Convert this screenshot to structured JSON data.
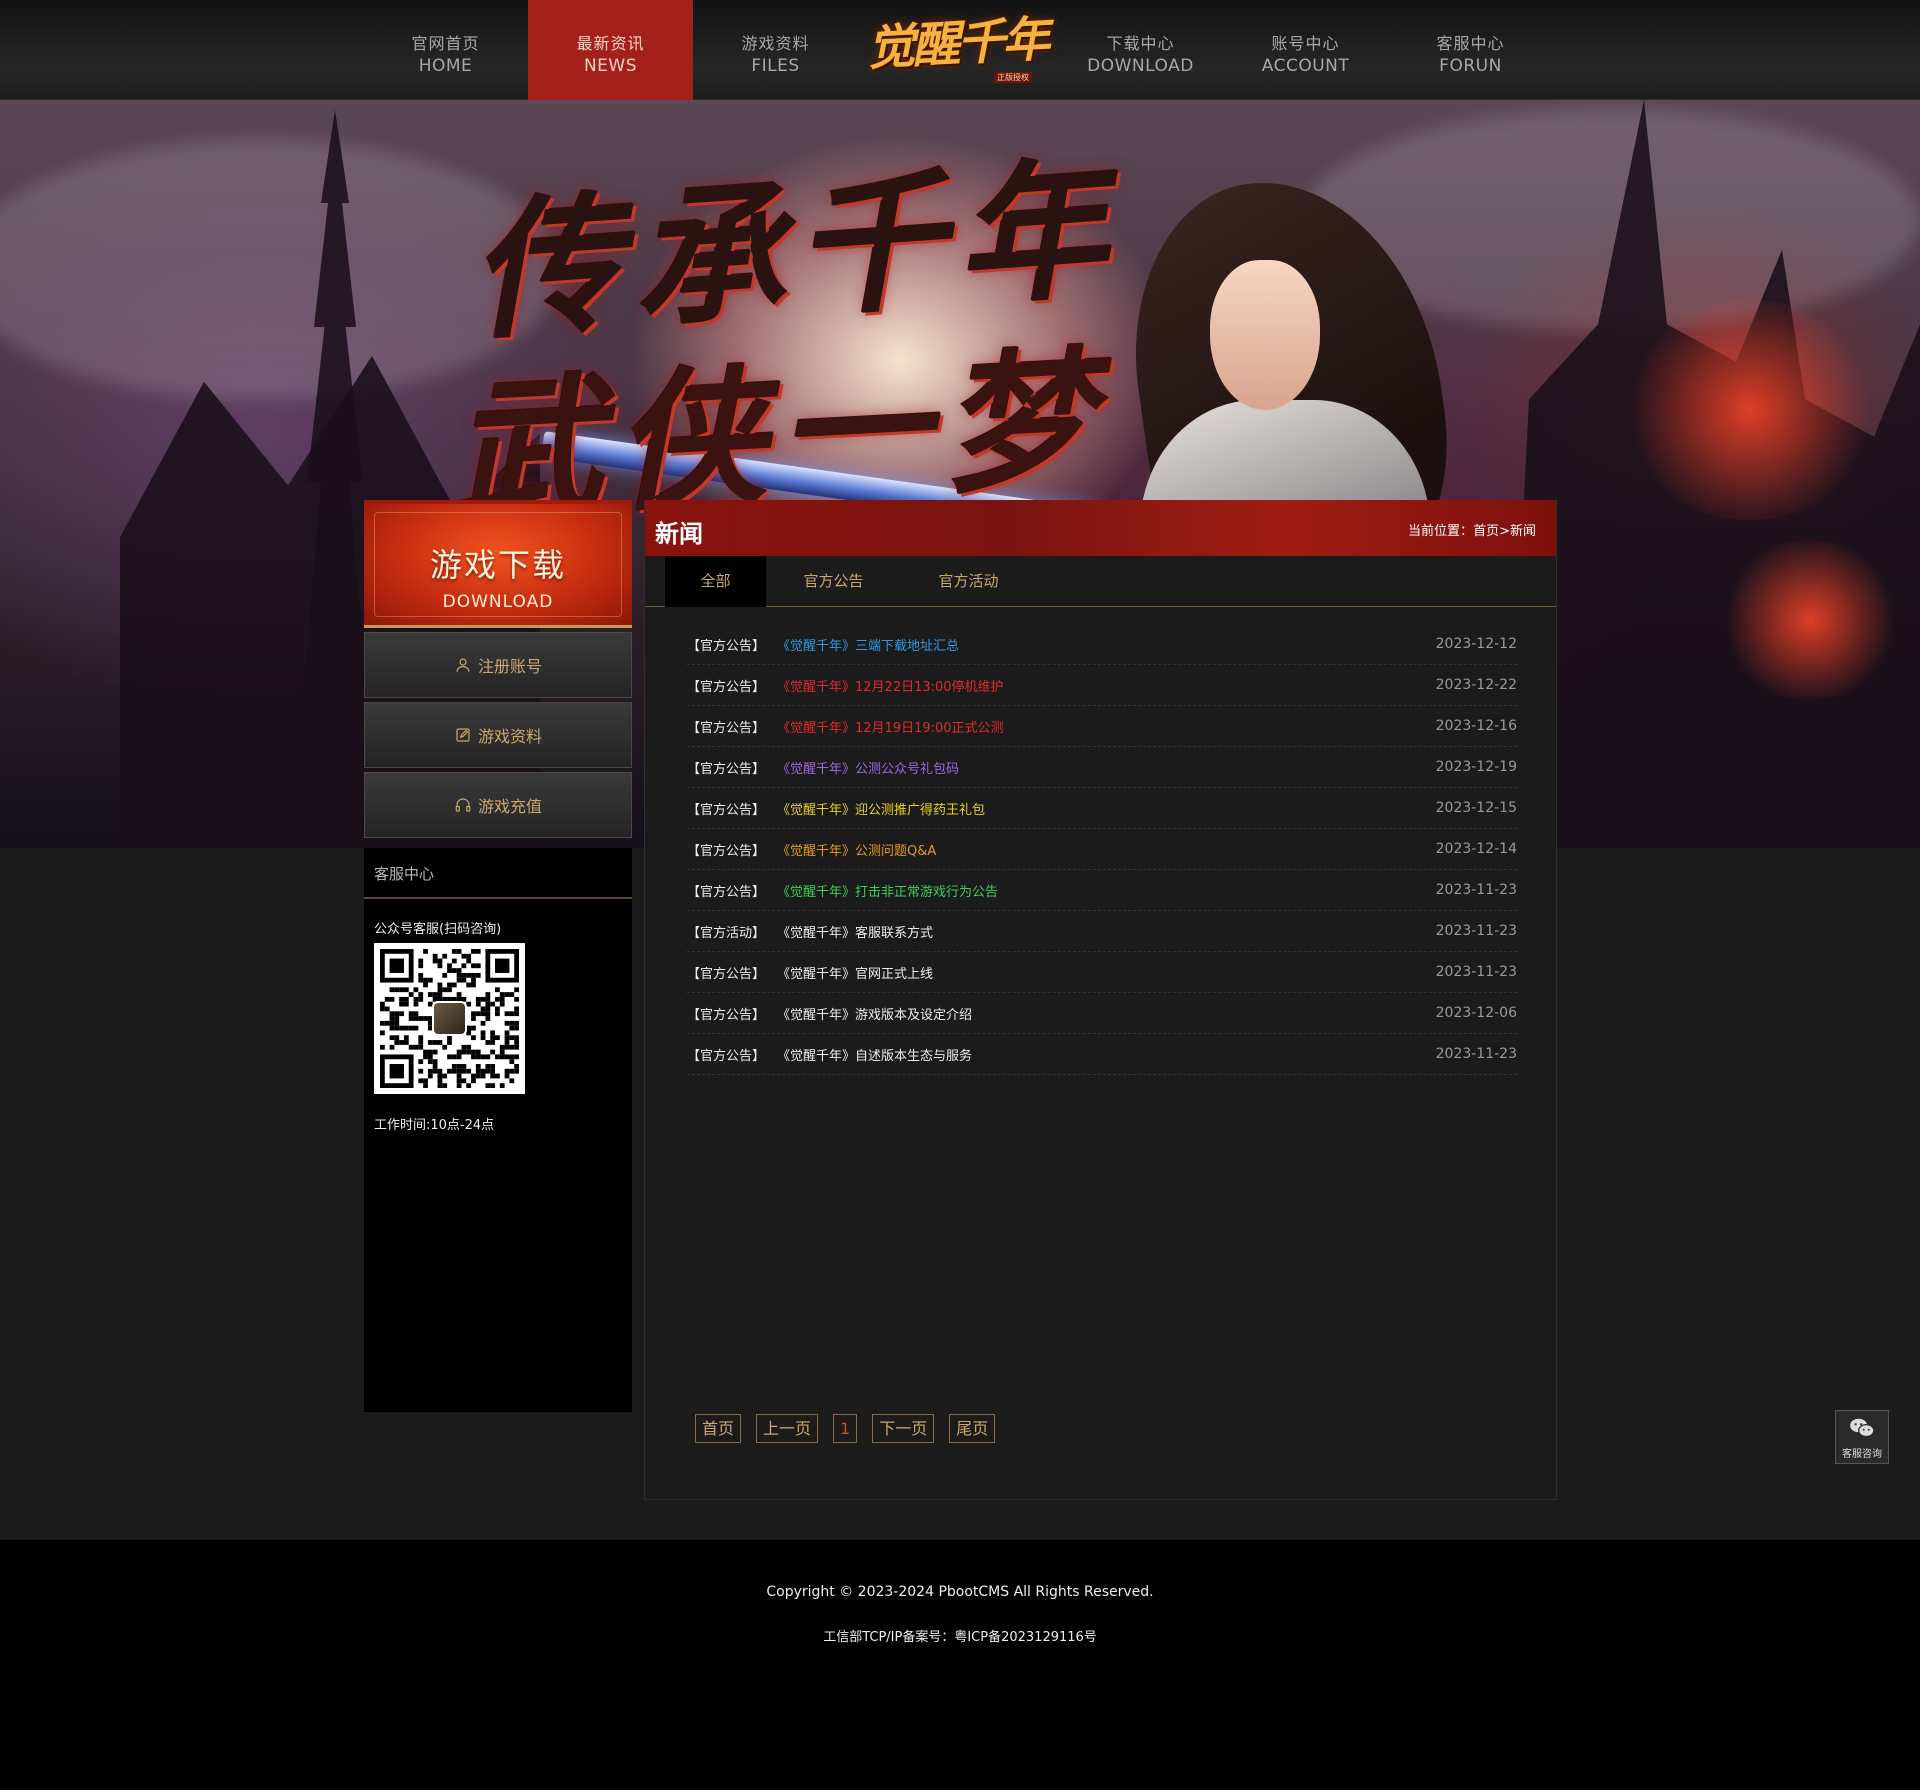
{
  "nav": {
    "left": [
      {
        "cn": "官网首页",
        "en": "HOME"
      },
      {
        "cn": "最新资讯",
        "en": "NEWS"
      },
      {
        "cn": "游戏资料",
        "en": "FILES"
      }
    ],
    "right": [
      {
        "cn": "下载中心",
        "en": "DOWNLOAD"
      },
      {
        "cn": "账号中心",
        "en": "ACCOUNT"
      },
      {
        "cn": "客服中心",
        "en": "FORUN"
      }
    ],
    "active": "NEWS",
    "logo_text": "觉醒千年",
    "logo_sub": "正版授权"
  },
  "banner": {
    "line1": "传承千年",
    "line2": "武侠一梦"
  },
  "sidebar": {
    "download_cn": "游戏下载",
    "download_en": "DOWNLOAD",
    "buttons": [
      {
        "label": "注册账号",
        "icon": "user-icon"
      },
      {
        "label": "游戏资料",
        "icon": "edit-icon"
      },
      {
        "label": "游戏充值",
        "icon": "headset-icon"
      }
    ],
    "cs_title": "客服中心",
    "cs_label": "公众号客服(扫码咨询)",
    "cs_hours": "工作时间:10点-24点"
  },
  "main": {
    "title": "新闻",
    "crumb_prefix": "当前位置：",
    "crumb_home": "首页",
    "crumb_sep": ">",
    "crumb_current": "新闻",
    "tabs": [
      "全部",
      "官方公告",
      "官方活动"
    ],
    "news": [
      {
        "cat": "【官方公告】",
        "title": "《觉醒千年》三端下载地址汇总",
        "date": "2023-12-12",
        "color": "#2f9be0"
      },
      {
        "cat": "【官方公告】",
        "title": "《觉醒千年》12月22日13:00停机维护",
        "date": "2023-12-22",
        "color": "#e02b2b"
      },
      {
        "cat": "【官方公告】",
        "title": "《觉醒千年》12月19日19:00正式公测",
        "date": "2023-12-16",
        "color": "#e02b2b"
      },
      {
        "cat": "【官方公告】",
        "title": "《觉醒千年》公测公众号礼包码",
        "date": "2023-12-19",
        "color": "#a066e0"
      },
      {
        "cat": "【官方公告】",
        "title": "《觉醒千年》迎公测推广得药王礼包",
        "date": "2023-12-15",
        "color": "#e8d21c"
      },
      {
        "cat": "【官方公告】",
        "title": "《觉醒千年》公测问题Q&A",
        "date": "2023-12-14",
        "color": "#e59a22"
      },
      {
        "cat": "【官方公告】",
        "title": "《觉醒千年》打击非正常游戏行为公告",
        "date": "2023-11-23",
        "color": "#3ecf5a"
      },
      {
        "cat": "【官方活动】",
        "title": "《觉醒千年》客服联系方式",
        "date": "2023-11-23",
        "color": "#eeeeee"
      },
      {
        "cat": "【官方公告】",
        "title": "《觉醒千年》官网正式上线",
        "date": "2023-11-23",
        "color": "#eeeeee"
      },
      {
        "cat": "【官方公告】",
        "title": "《觉醒千年》游戏版本及设定介绍",
        "date": "2023-12-06",
        "color": "#eeeeee"
      },
      {
        "cat": "【官方公告】",
        "title": "《觉醒千年》自述版本生态与服务",
        "date": "2023-11-23",
        "color": "#eeeeee"
      }
    ],
    "pager": [
      "首页",
      "上一页",
      "1",
      "下一页",
      "尾页"
    ]
  },
  "float_cs": {
    "label": "客服咨询",
    "icon": "wechat-icon"
  },
  "footer": {
    "copyright": "Copyright © 2023-2024 PbootCMS All Rights Reserved.",
    "icp": "工信部TCP/IP备案号：粤ICP备2023129116号"
  }
}
